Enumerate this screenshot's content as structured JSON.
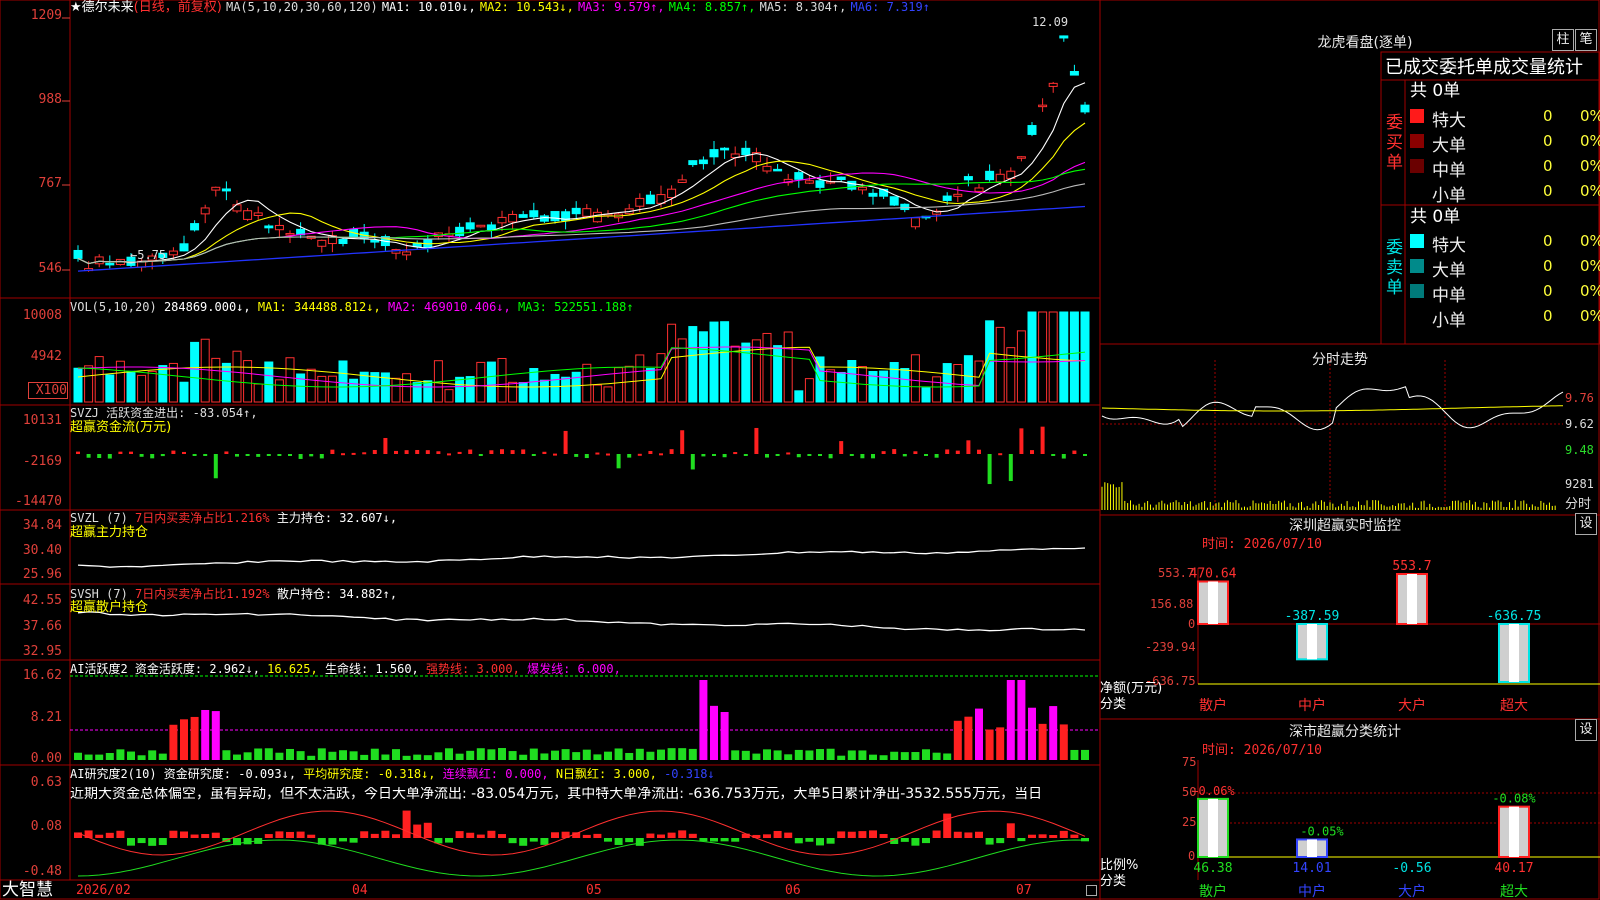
{
  "app": {
    "logo": "大智慧"
  },
  "stock": {
    "star": "★",
    "name": "德尔未来",
    "period": "(日线，前复权)",
    "ma_header": "MA(5,10,20,30,60,120)",
    "ma1": "MA1: 10.010↓,",
    "ma2": "MA2: 10.543↓,",
    "ma3": "MA3: 9.579↑,",
    "ma4": "MA4: 8.857↑,",
    "ma5": "MA5: 8.304↑,",
    "ma6": "MA6: 7.319↑",
    "high_label": "12.09",
    "low_label": "←5.75"
  },
  "axes": {
    "price": [
      "1209",
      "988",
      "767",
      "546"
    ],
    "vol": [
      "10008",
      "4942",
      "X100"
    ],
    "svzj": [
      "10131",
      "-2169",
      "-14470"
    ],
    "svzl": [
      "34.84",
      "30.40",
      "25.96"
    ],
    "svsh": [
      "42.55",
      "37.66",
      "32.95"
    ],
    "ai1": [
      "16.62",
      "8.21",
      "0.00"
    ],
    "ai2": [
      "0.63",
      "0.08",
      "-0.48"
    ],
    "dates": [
      "2026/02",
      "04",
      "05",
      "06",
      "07"
    ]
  },
  "indicators": {
    "vol": {
      "head": "VOL(5,10,20)",
      "v": "284869.000↓,",
      "ma1": "MA1: 344488.812↓,",
      "ma2": "MA2: 469010.406↓,",
      "ma3": "MA3: 522551.188↑"
    },
    "svzj": {
      "head": "SVZJ  活跃资金进出: -83.054↑,",
      "sub": "超赢资金流(万元)"
    },
    "svzl": {
      "head": "SVZL (7)",
      "a": "7日内买卖净占比1.216%",
      "b": "主力持仓: 32.607↓,",
      "sub": "超赢主力持仓"
    },
    "svsh": {
      "head": "SVSH (7)",
      "a": "7日内买卖净占比1.192%",
      "b": "散户持仓: 34.882↑,",
      "sub": "超赢散户持仓"
    },
    "ai1": {
      "head": "AI活跃度2 资金活跃度: 2.962↓,",
      "a": "16.625,",
      "b": "生命线: 1.560,",
      "c": "强势线: 3.000,",
      "d": "爆发线: 6.000,"
    },
    "ai2": {
      "head": "AI研究度2(10) 资金研究度: -0.093↓,",
      "a": "平均研究度: -0.318↓,",
      "b": "连续飘红: 0.000,",
      "c": "N日飘红: 3.000,",
      "d": "-0.318↓",
      "text": "近期大资金总体偏空，虽有异动，但不太活跃，今日大单净流出: -83.054万元，其中特大单净流出: -636.753万元，大单5日累计净出-3532.555万元，当日"
    }
  },
  "longhu": {
    "title": "龙虎看盘(逐单)",
    "btn_bar": "柱",
    "btn_pen": "笔",
    "tabs": "已成交委托单成交量统计",
    "buy_label": "委买单",
    "sell_label": "委卖单",
    "buy_total": "共 0单",
    "sell_total": "共 0单",
    "buy_rows": [
      {
        "name": "特大",
        "count": "0",
        "pct": "0%",
        "color": "#ff1a1a"
      },
      {
        "name": "大单",
        "count": "0",
        "pct": "0%",
        "color": "#8a0000"
      },
      {
        "name": "中单",
        "count": "0",
        "pct": "0%",
        "color": "#6a0000"
      },
      {
        "name": "小单",
        "count": "0",
        "pct": "0%",
        "color": "#000000"
      }
    ],
    "sell_rows": [
      {
        "name": "特大",
        "count": "0",
        "pct": "0%",
        "color": "#00ffff"
      },
      {
        "name": "大单",
        "count": "0",
        "pct": "0%",
        "color": "#008a8a"
      },
      {
        "name": "中单",
        "count": "0",
        "pct": "0%",
        "color": "#007a7a"
      },
      {
        "name": "小单",
        "count": "0",
        "pct": "0%",
        "color": "#000000"
      }
    ]
  },
  "intraday": {
    "title": "分时走势",
    "axis": [
      "9.76",
      "9.62",
      "9.48",
      "9281",
      "分时"
    ]
  },
  "sz_monitor": {
    "title": "深圳超赢实时监控",
    "btn": "设",
    "time": "时间: 2026/07/10",
    "axis": [
      "553.7",
      "156.88",
      "0",
      "-239.94",
      "-636.75"
    ],
    "ylabel": "净额(万元)",
    "xlabel": "分类",
    "chart_data": {
      "type": "bar",
      "categories": [
        "散户",
        "中户",
        "大户",
        "超大"
      ],
      "values": [
        470.64,
        -387.59,
        553.7,
        -636.75
      ],
      "labels": [
        "470.64",
        "-387.59",
        "553.7",
        "-636.75"
      ],
      "ylim": [
        -636.75,
        553.7
      ]
    }
  },
  "sz_stat": {
    "title": "深市超赢分类统计",
    "btn": "设",
    "time": "时间: 2026/07/10",
    "axis": [
      "75",
      "50",
      "25",
      "0"
    ],
    "ylabel": "比例%",
    "xlabel": "分类",
    "chart_data": {
      "type": "bar",
      "categories": [
        "散户",
        "中户",
        "大户",
        "超大"
      ],
      "values": [
        46.38,
        14.01,
        -0.56,
        40.17
      ],
      "changes": [
        "+0.06%",
        "-0.05%",
        "",
        "-0.08%"
      ],
      "values_text": [
        "46.38",
        "14.01",
        "-0.56",
        "40.17"
      ],
      "ylim": [
        0,
        75
      ]
    }
  }
}
